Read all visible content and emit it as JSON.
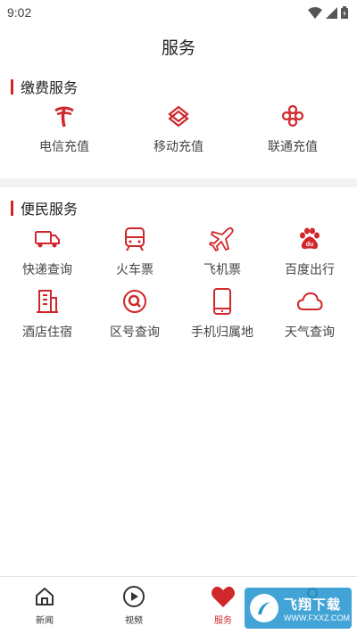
{
  "status": {
    "time": "9:02"
  },
  "header": {
    "title": "服务"
  },
  "payment": {
    "title": "缴费服务",
    "items": [
      {
        "label": "电信充值",
        "icon": "telecom-logo-icon"
      },
      {
        "label": "移动充值",
        "icon": "mobile-logo-icon"
      },
      {
        "label": "联通充值",
        "icon": "unicom-logo-icon"
      }
    ]
  },
  "convenience": {
    "title": "便民服务",
    "items": [
      {
        "label": "快递查询",
        "icon": "truck-icon"
      },
      {
        "label": "火车票",
        "icon": "train-icon"
      },
      {
        "label": "飞机票",
        "icon": "airplane-icon"
      },
      {
        "label": "百度出行",
        "icon": "baidu-paw-icon"
      },
      {
        "label": "酒店住宿",
        "icon": "building-icon"
      },
      {
        "label": "区号查询",
        "icon": "search-icon"
      },
      {
        "label": "手机归属地",
        "icon": "phone-icon"
      },
      {
        "label": "天气查询",
        "icon": "cloud-icon"
      }
    ]
  },
  "tabs": [
    {
      "label": "新闻",
      "icon": "home-icon"
    },
    {
      "label": "视频",
      "icon": "play-icon"
    },
    {
      "label": "服务",
      "icon": "heart-icon",
      "active": true
    },
    {
      "label": "",
      "icon": "profile-icon"
    }
  ],
  "watermark": {
    "title": "飞翔下载",
    "url": "WWW.FXXZ.COM"
  },
  "colors": {
    "accent": "#d0272b",
    "divider": "#f2f2f2"
  }
}
